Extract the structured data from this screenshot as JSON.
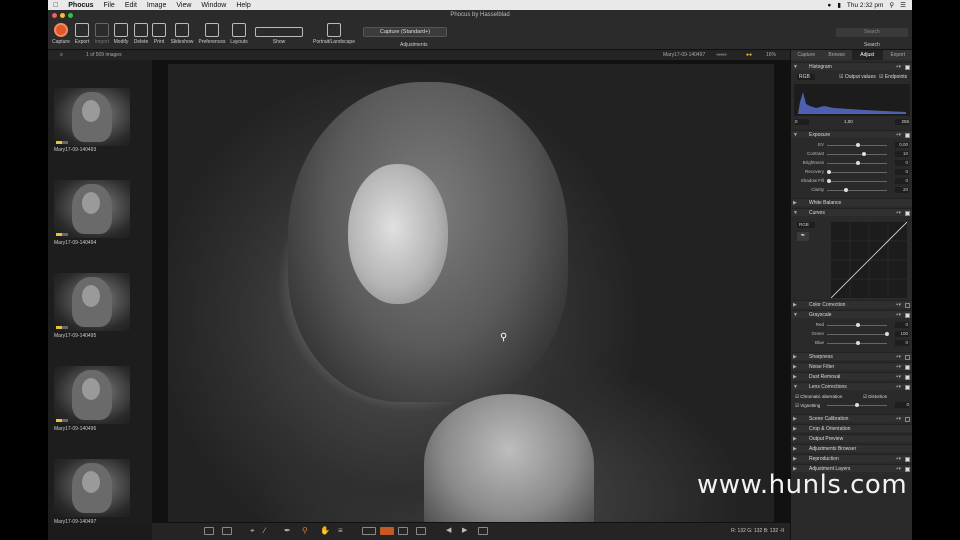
{
  "menubar": {
    "app": "Phocus",
    "items": [
      "File",
      "Edit",
      "Image",
      "View",
      "Window",
      "Help"
    ],
    "clock": "Thu 2:32 pm"
  },
  "window": {
    "title": "Phocus by Hasselblad"
  },
  "toolbar": {
    "buttons": [
      "Capture",
      "Export",
      "Import",
      "Modify",
      "Delete",
      "Print",
      "Slideshow",
      "Preferences",
      "Layouts",
      "Show",
      "Portrait/Landscape"
    ],
    "preset": "Capture (Standard+)",
    "adjustments_label": "Adjustments",
    "search_placeholder": "Search",
    "search_label": "Search"
  },
  "browser": {
    "count": "1 of 509 images",
    "current_file": "Mary17-09-140497",
    "zoom": "16%"
  },
  "thumbnails": [
    {
      "name": "Mary17-09-140493"
    },
    {
      "name": "Mary17-09-140494"
    },
    {
      "name": "Mary17-09-140495"
    },
    {
      "name": "Mary17-09-140496"
    },
    {
      "name": "Mary17-09-140497"
    }
  ],
  "panel": {
    "tabs": [
      "Capture",
      "Browse",
      "Adjust",
      "Export"
    ],
    "active_tab": "Adjust",
    "histogram": {
      "title": "Histogram",
      "channel": "RGB",
      "output_values": "Output values",
      "endpoints": "Endpoints",
      "min": "0",
      "max": "255",
      "mid": "1,00"
    },
    "exposure": {
      "title": "Exposure",
      "sliders": [
        {
          "label": "EV",
          "value": "0,00",
          "pos": 0.5
        },
        {
          "label": "Contrast",
          "value": "10",
          "pos": 0.6
        },
        {
          "label": "Brightness",
          "value": "0",
          "pos": 0.5
        },
        {
          "label": "Recovery",
          "value": "0",
          "pos": 0.0
        },
        {
          "label": "Shadow Fill",
          "value": "0",
          "pos": 0.0
        },
        {
          "label": "Clarity",
          "value": "20",
          "pos": 0.3
        }
      ]
    },
    "white_balance": "White Balance",
    "curves": {
      "title": "Curves",
      "channel": "RGB"
    },
    "color_correction": "Color Correction",
    "grayscale": {
      "title": "Grayscale",
      "sliders": [
        {
          "label": "Red",
          "value": "0",
          "pos": 0.5
        },
        {
          "label": "Green",
          "value": "100",
          "pos": 1.0
        },
        {
          "label": "Blue",
          "value": "0",
          "pos": 0.5
        }
      ]
    },
    "sharpness": "Sharpness",
    "noise_filter": "Noise Filter",
    "dust_removal": "Dust Removal",
    "lens_corrections": {
      "title": "Lens Corrections",
      "chromatic": "Chromatic aberration",
      "distortion": "Distortion",
      "vignetting": "Vignetting",
      "vignetting_value": "0"
    },
    "scene_calibration": "Scene Calibration",
    "crop": "Crop & Orientation",
    "output_preview": "Output Preview",
    "adjustments_browser": "Adjustments Browser",
    "reproduction": "Reproduction",
    "adjustment_layers": "Adjustment Layers"
  },
  "status": {
    "r": "R: 132",
    "g": "G: 132",
    "b": "B: 132",
    "extra": "-II"
  },
  "watermark": "www.hunls.com"
}
